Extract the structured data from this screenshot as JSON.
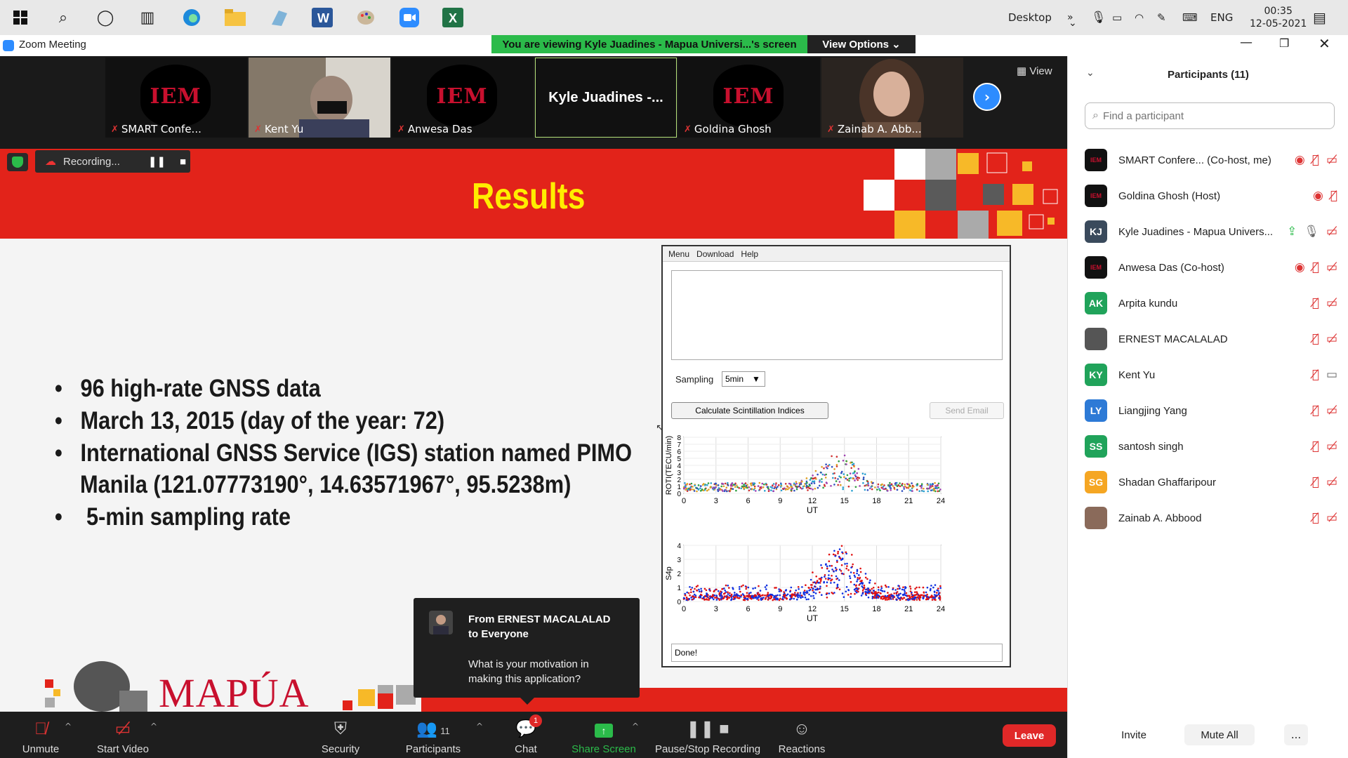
{
  "taskbar": {
    "desktop_label": "Desktop",
    "language": "ENG",
    "time": "00:35",
    "date": "12-05-2021"
  },
  "window": {
    "title": "Zoom Meeting"
  },
  "banner": {
    "text": "You are viewing Kyle Juadines - Mapua Universi...'s screen",
    "options": "View Options"
  },
  "videostrip": {
    "view_label": "View",
    "tiles": [
      {
        "name": "SMART Confe..."
      },
      {
        "name": "Kent Yu"
      },
      {
        "name": "Anwesa Das"
      },
      {
        "name": "Kyle Juadines -..."
      },
      {
        "name": "Goldina Ghosh"
      },
      {
        "name": "Zainab A. Abb..."
      }
    ],
    "iem_logo": "IEM"
  },
  "recording": {
    "label": "Recording..."
  },
  "slide": {
    "title": "Results",
    "bullets": [
      "96 high-rate GNSS data",
      "March 13, 2015 (day of the year: 72)",
      "International GNSS Service (IGS) station named PIMO",
      "Manila (121.07773190°, 14.63571967°, 95.5238m)",
      "5-min sampling rate"
    ],
    "logo_text": "MAPÚA"
  },
  "app": {
    "menu": [
      "Menu",
      "Download",
      "Help"
    ],
    "sampling_label": "Sampling",
    "sampling_value": "5min",
    "calc_button": "Calculate Scintillation Indices",
    "email_button": "Send Email",
    "status": "Done!",
    "plot1": {
      "ylabel": "ROTI(TECU/min)",
      "xlabel": "UT",
      "yticks": [
        "0",
        "1",
        "2",
        "3",
        "4",
        "5",
        "6",
        "7",
        "8"
      ],
      "xticks": [
        "0",
        "3",
        "6",
        "9",
        "12",
        "15",
        "18",
        "21",
        "24"
      ]
    },
    "plot2": {
      "ylabel": "S4p",
      "xlabel": "UT",
      "yticks": [
        "0",
        "1",
        "2",
        "3",
        "4"
      ],
      "xticks": [
        "0",
        "3",
        "6",
        "9",
        "12",
        "15",
        "18",
        "21",
        "24"
      ]
    }
  },
  "chat": {
    "from": "From ERNEST MACALALAD",
    "to": "to Everyone",
    "message": "What is your motivation in making this application?"
  },
  "toolbar": {
    "unmute": "Unmute",
    "start_video": "Start Video",
    "security": "Security",
    "participants": "Participants",
    "participants_count": "11",
    "chat": "Chat",
    "chat_badge": "1",
    "share": "Share Screen",
    "record": "Pause/Stop Recording",
    "reactions": "Reactions",
    "leave": "Leave"
  },
  "panel": {
    "title": "Participants (11)",
    "search_placeholder": "Find a participant",
    "participants": [
      {
        "initials": "IEM",
        "name": "SMART Confere...  (Co-host, me)",
        "color": "#111111"
      },
      {
        "initials": "IEM",
        "name": "Goldina Ghosh (Host)",
        "color": "#111111"
      },
      {
        "initials": "KJ",
        "name": "Kyle Juadines - Mapua Univers...",
        "color": "#3a4a5c"
      },
      {
        "initials": "IEM",
        "name": "Anwesa Das (Co-host)",
        "color": "#111111"
      },
      {
        "initials": "AK",
        "name": "Arpita kundu",
        "color": "#20a35a"
      },
      {
        "initials": "",
        "name": "ERNEST MACALALAD",
        "color": "#555555"
      },
      {
        "initials": "KY",
        "name": "Kent Yu",
        "color": "#20a35a"
      },
      {
        "initials": "LY",
        "name": "Liangjing Yang",
        "color": "#2d7ad6"
      },
      {
        "initials": "SS",
        "name": "santosh singh",
        "color": "#20a35a"
      },
      {
        "initials": "SG",
        "name": "Shadan Ghaffaripour",
        "color": "#f5a623"
      },
      {
        "initials": "",
        "name": "Zainab A. Abbood",
        "color": "#8a6a5a"
      }
    ],
    "invite": "Invite",
    "mute_all": "Mute All",
    "more": "..."
  }
}
